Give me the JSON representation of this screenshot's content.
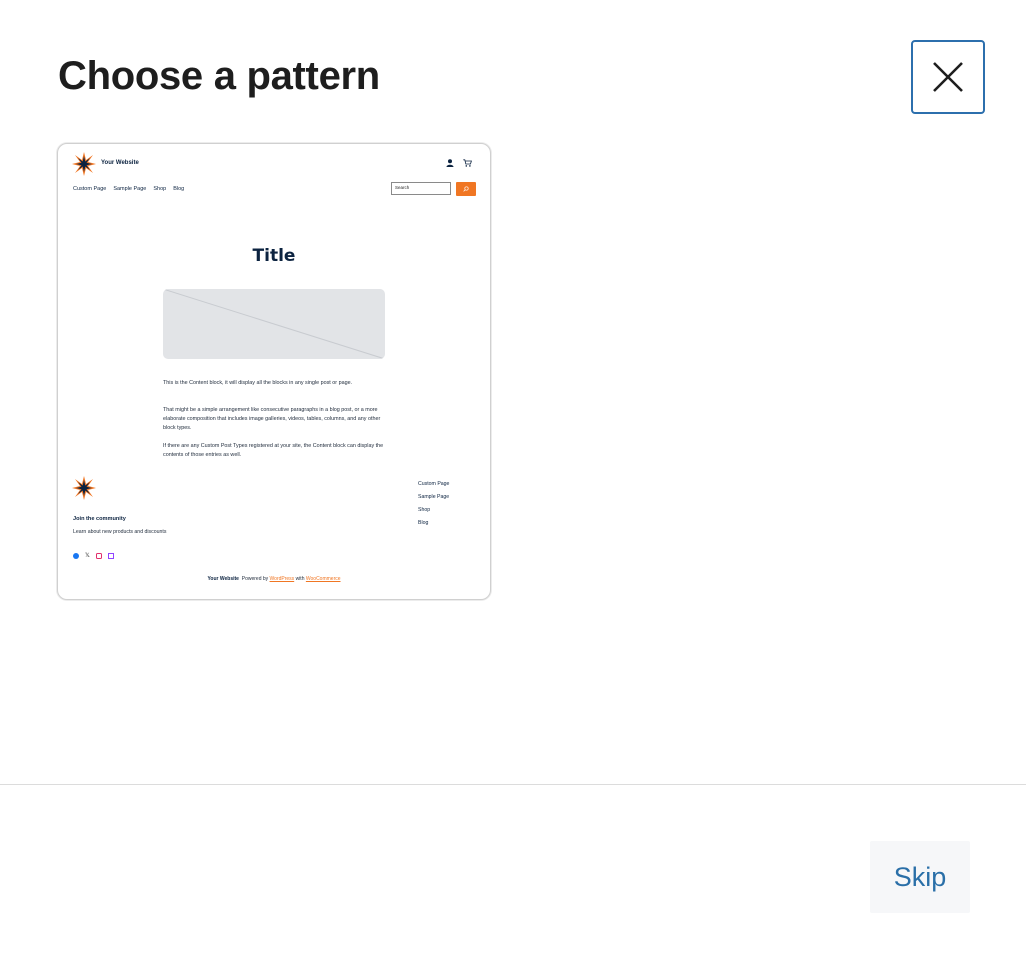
{
  "modal": {
    "title": "Choose a pattern",
    "close_icon": "close-icon"
  },
  "pattern_preview": {
    "site_title": "Your Website",
    "header_icons": [
      "account-icon",
      "cart-icon"
    ],
    "nav": [
      "Custom Page",
      "Sample Page",
      "Shop",
      "Blog"
    ],
    "search_placeholder": "Search",
    "search_icon": "search-icon",
    "title": "Title",
    "paragraphs": [
      "This is the Content block, it will display all the blocks in any single post or page.",
      "That might be a simple arrangement like consecutive paragraphs in a blog post, or a more elaborate composition that includes image galleries, videos, tables, columns, and any other block types.",
      "If there are any Custom Post Types registered at your site, the Content block can display the contents of those entries as well."
    ],
    "footer_links": [
      "Custom Page",
      "Sample Page",
      "Shop",
      "Blog"
    ],
    "community_heading": "Join the community",
    "community_text": "Learn about new products and discounts",
    "social_icons": [
      "facebook-icon",
      "x-icon",
      "instagram-icon",
      "twitch-icon"
    ],
    "credit": {
      "site": "Your Website",
      "powered_by": "Powered by",
      "wordpress": "WordPress",
      "with": "with",
      "woocommerce": "WooCommerce"
    },
    "colors": {
      "accent": "#f07623",
      "navy": "#0c2340"
    }
  },
  "footer": {
    "skip_label": "Skip"
  },
  "colors": {
    "focus_border": "#2c6fad",
    "skip_text": "#2a6fa8"
  }
}
